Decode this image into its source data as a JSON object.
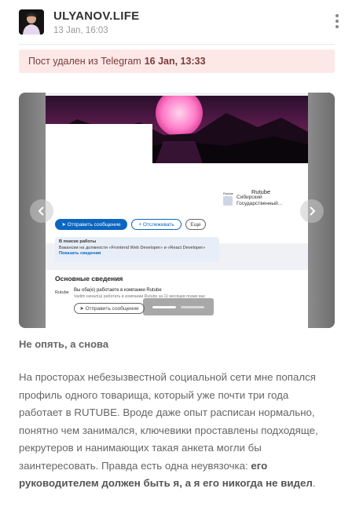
{
  "channel": {
    "name": "ULYANOV.LIFE",
    "date": "13 Jan, 16:03",
    "avatar_icon": "avatar-photo"
  },
  "menu_icon": "kebab-menu-icon",
  "deleted_notice": {
    "text": "Пост удален из Telegram",
    "date": "16 Jan, 13:33",
    "background": "#fde8e8"
  },
  "gallery": {
    "slide_count": 2,
    "active_slide": 1,
    "arrow_left_icon": "chevron-left-icon",
    "arrow_right_icon": "chevron-right-icon",
    "screenshot": {
      "company_label": "Rutube",
      "company_name": "Rutube",
      "university": "Сибирский Государственный...",
      "send_button": "➤ Отправить сообщение",
      "follow_button": "+ Отслеживать",
      "more_button": "Еще",
      "seeking_title": "В поиске работы",
      "seeking_text": "Вакансии на должности «Frontend Web Developer» и «React Developer»",
      "seeking_link": "Показать сведения",
      "about_title": "Основные сведения",
      "about_company": "Rutube",
      "about_line1": "Вы оба(е) работаете в компании Rutube",
      "about_line2": "Vadim начал(а) работать в компании Rutube за 11 месяцев позже вас",
      "about_button": "➤ Отправить сообщение"
    }
  },
  "post": {
    "title": "Не опять, а снова",
    "body_plain": "На просторах небезызвестной социальной сети мне попался профиль одного товарища, который уже почти три года работает в RUTUBE. Вроде даже опыт расписан нормально, понятно чем занимался, ключевики проставлены подходяще, рекрутеров и нанимающих такая анкета могли бы заинтересовать. Правда есть одна неувязочка:",
    "body_bold": "его руководителем должен быть я, а я его никогда не видел",
    "body_end": "."
  }
}
